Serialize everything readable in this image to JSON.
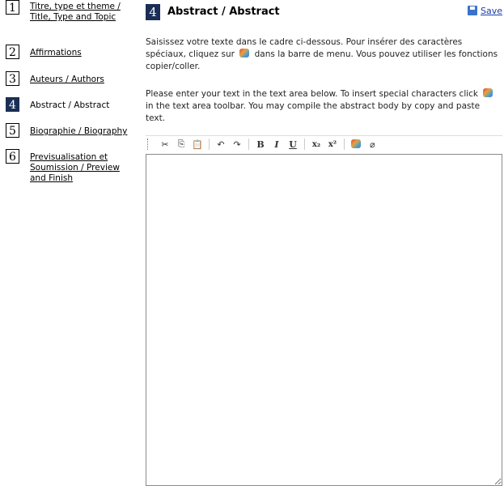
{
  "steps": [
    {
      "num": "1",
      "label": "Titre, type et theme / Title, Type and Topic",
      "link": true
    },
    {
      "num": "2",
      "label": "Affirmations",
      "link": true
    },
    {
      "num": "3",
      "label": "Auteurs / Authors",
      "link": true
    },
    {
      "num": "4",
      "label": "Abstract / Abstract",
      "link": false,
      "active": true
    },
    {
      "num": "5",
      "label": "Biographie / Biography",
      "link": true
    },
    {
      "num": "6",
      "label": "Previsualisation et Soumission / Preview and Finish",
      "link": true
    }
  ],
  "header": {
    "num": "4",
    "title": "Abstract / Abstract",
    "save_label": "Save"
  },
  "instructions": {
    "fr_before": "Saisissez votre texte dans le cadre ci-dessous. Pour insérer des caractères spéciaux, cliquez sur",
    "fr_after": "dans la barre de menu. Vous pouvez utiliser les fonctions copier/coller.",
    "en_before": "Please enter your text in the text area below. To insert special characters click",
    "en_after": "in the text area toolbar. You may compile the abstract body by copy and paste text."
  },
  "toolbar": {
    "bold": "B",
    "italic": "I",
    "underline": "U",
    "subscript": "x₂",
    "superscript": "x²",
    "icons": [
      "cut-icon",
      "copy-icon",
      "paste-icon",
      "undo-icon",
      "redo-icon",
      "special-chars-icon",
      "eraser-icon"
    ]
  },
  "editor": {
    "value": ""
  }
}
